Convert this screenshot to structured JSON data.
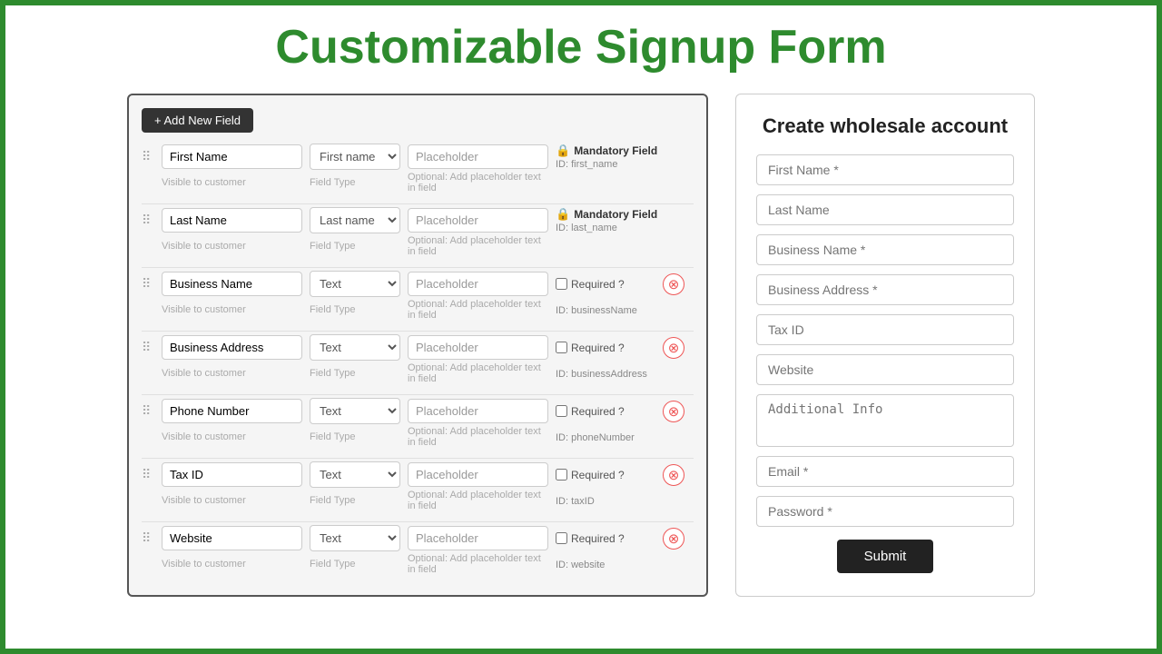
{
  "page": {
    "title": "Customizable Signup Form"
  },
  "left_panel": {
    "add_button_label": "+ Add New Field",
    "fields": [
      {
        "name": "First Name",
        "type_placeholder": "First name",
        "placeholder": "Placeholder",
        "visible_label": "Visible to customer",
        "field_type_label": "Field Type",
        "placeholder_hint": "Optional: Add placeholder text in field",
        "mandatory": true,
        "mandatory_label": "Mandatory Field",
        "field_id": "ID: first_name",
        "deletable": false
      },
      {
        "name": "Last Name",
        "type_placeholder": "Last name",
        "placeholder": "Placeholder",
        "visible_label": "Visible to customer",
        "field_type_label": "Field Type",
        "placeholder_hint": "Optional: Add placeholder text in field",
        "mandatory": true,
        "mandatory_label": "Mandatory Field",
        "field_id": "ID: last_name",
        "deletable": false
      },
      {
        "name": "Business Name",
        "type_value": "Text",
        "placeholder": "Placeholder",
        "visible_label": "Visible to customer",
        "field_type_label": "Field Type",
        "placeholder_hint": "Optional: Add placeholder text in field",
        "required": false,
        "required_label": "Required ?",
        "field_id": "ID: businessName",
        "deletable": true
      },
      {
        "name": "Business Address",
        "type_value": "Text",
        "placeholder": "Placeholder",
        "visible_label": "Visible to customer",
        "field_type_label": "Field Type",
        "placeholder_hint": "Optional: Add placeholder text in field",
        "required": false,
        "required_label": "Required ?",
        "field_id": "ID: businessAddress",
        "deletable": true
      },
      {
        "name": "Phone Number",
        "type_value": "Text",
        "placeholder": "Placeholder",
        "visible_label": "Visible to customer",
        "field_type_label": "Field Type",
        "placeholder_hint": "Optional: Add placeholder text in field",
        "required": false,
        "required_label": "Required ?",
        "field_id": "ID: phoneNumber",
        "deletable": true
      },
      {
        "name": "Tax ID",
        "type_value": "Text",
        "placeholder": "Placeholder",
        "visible_label": "Visible to customer",
        "field_type_label": "Field Type",
        "placeholder_hint": "Optional: Add placeholder text in field",
        "required": false,
        "required_label": "Required ?",
        "field_id": "ID: taxID",
        "deletable": true
      },
      {
        "name": "Website",
        "type_value": "Text",
        "placeholder": "Placeholder",
        "visible_label": "Visible to customer",
        "field_type_label": "Field Type",
        "placeholder_hint": "Optional: Add placeholder text in field",
        "required": false,
        "required_label": "Required ?",
        "field_id": "ID: website",
        "deletable": true
      }
    ]
  },
  "right_panel": {
    "form_title": "Create wholesale account",
    "fields": [
      {
        "label": "First Name *",
        "type": "input"
      },
      {
        "label": "Last Name",
        "type": "input"
      },
      {
        "label": "Business Name *",
        "type": "input"
      },
      {
        "label": "Business Address *",
        "type": "input"
      },
      {
        "label": "Tax ID",
        "type": "input"
      },
      {
        "label": "Website",
        "type": "input"
      },
      {
        "label": "Additional Info",
        "type": "textarea"
      },
      {
        "label": "Email *",
        "type": "input"
      },
      {
        "label": "Password *",
        "type": "input"
      }
    ],
    "submit_label": "Submit"
  },
  "icons": {
    "drag": "⠿",
    "lock": "🔒",
    "delete": "⊗"
  }
}
